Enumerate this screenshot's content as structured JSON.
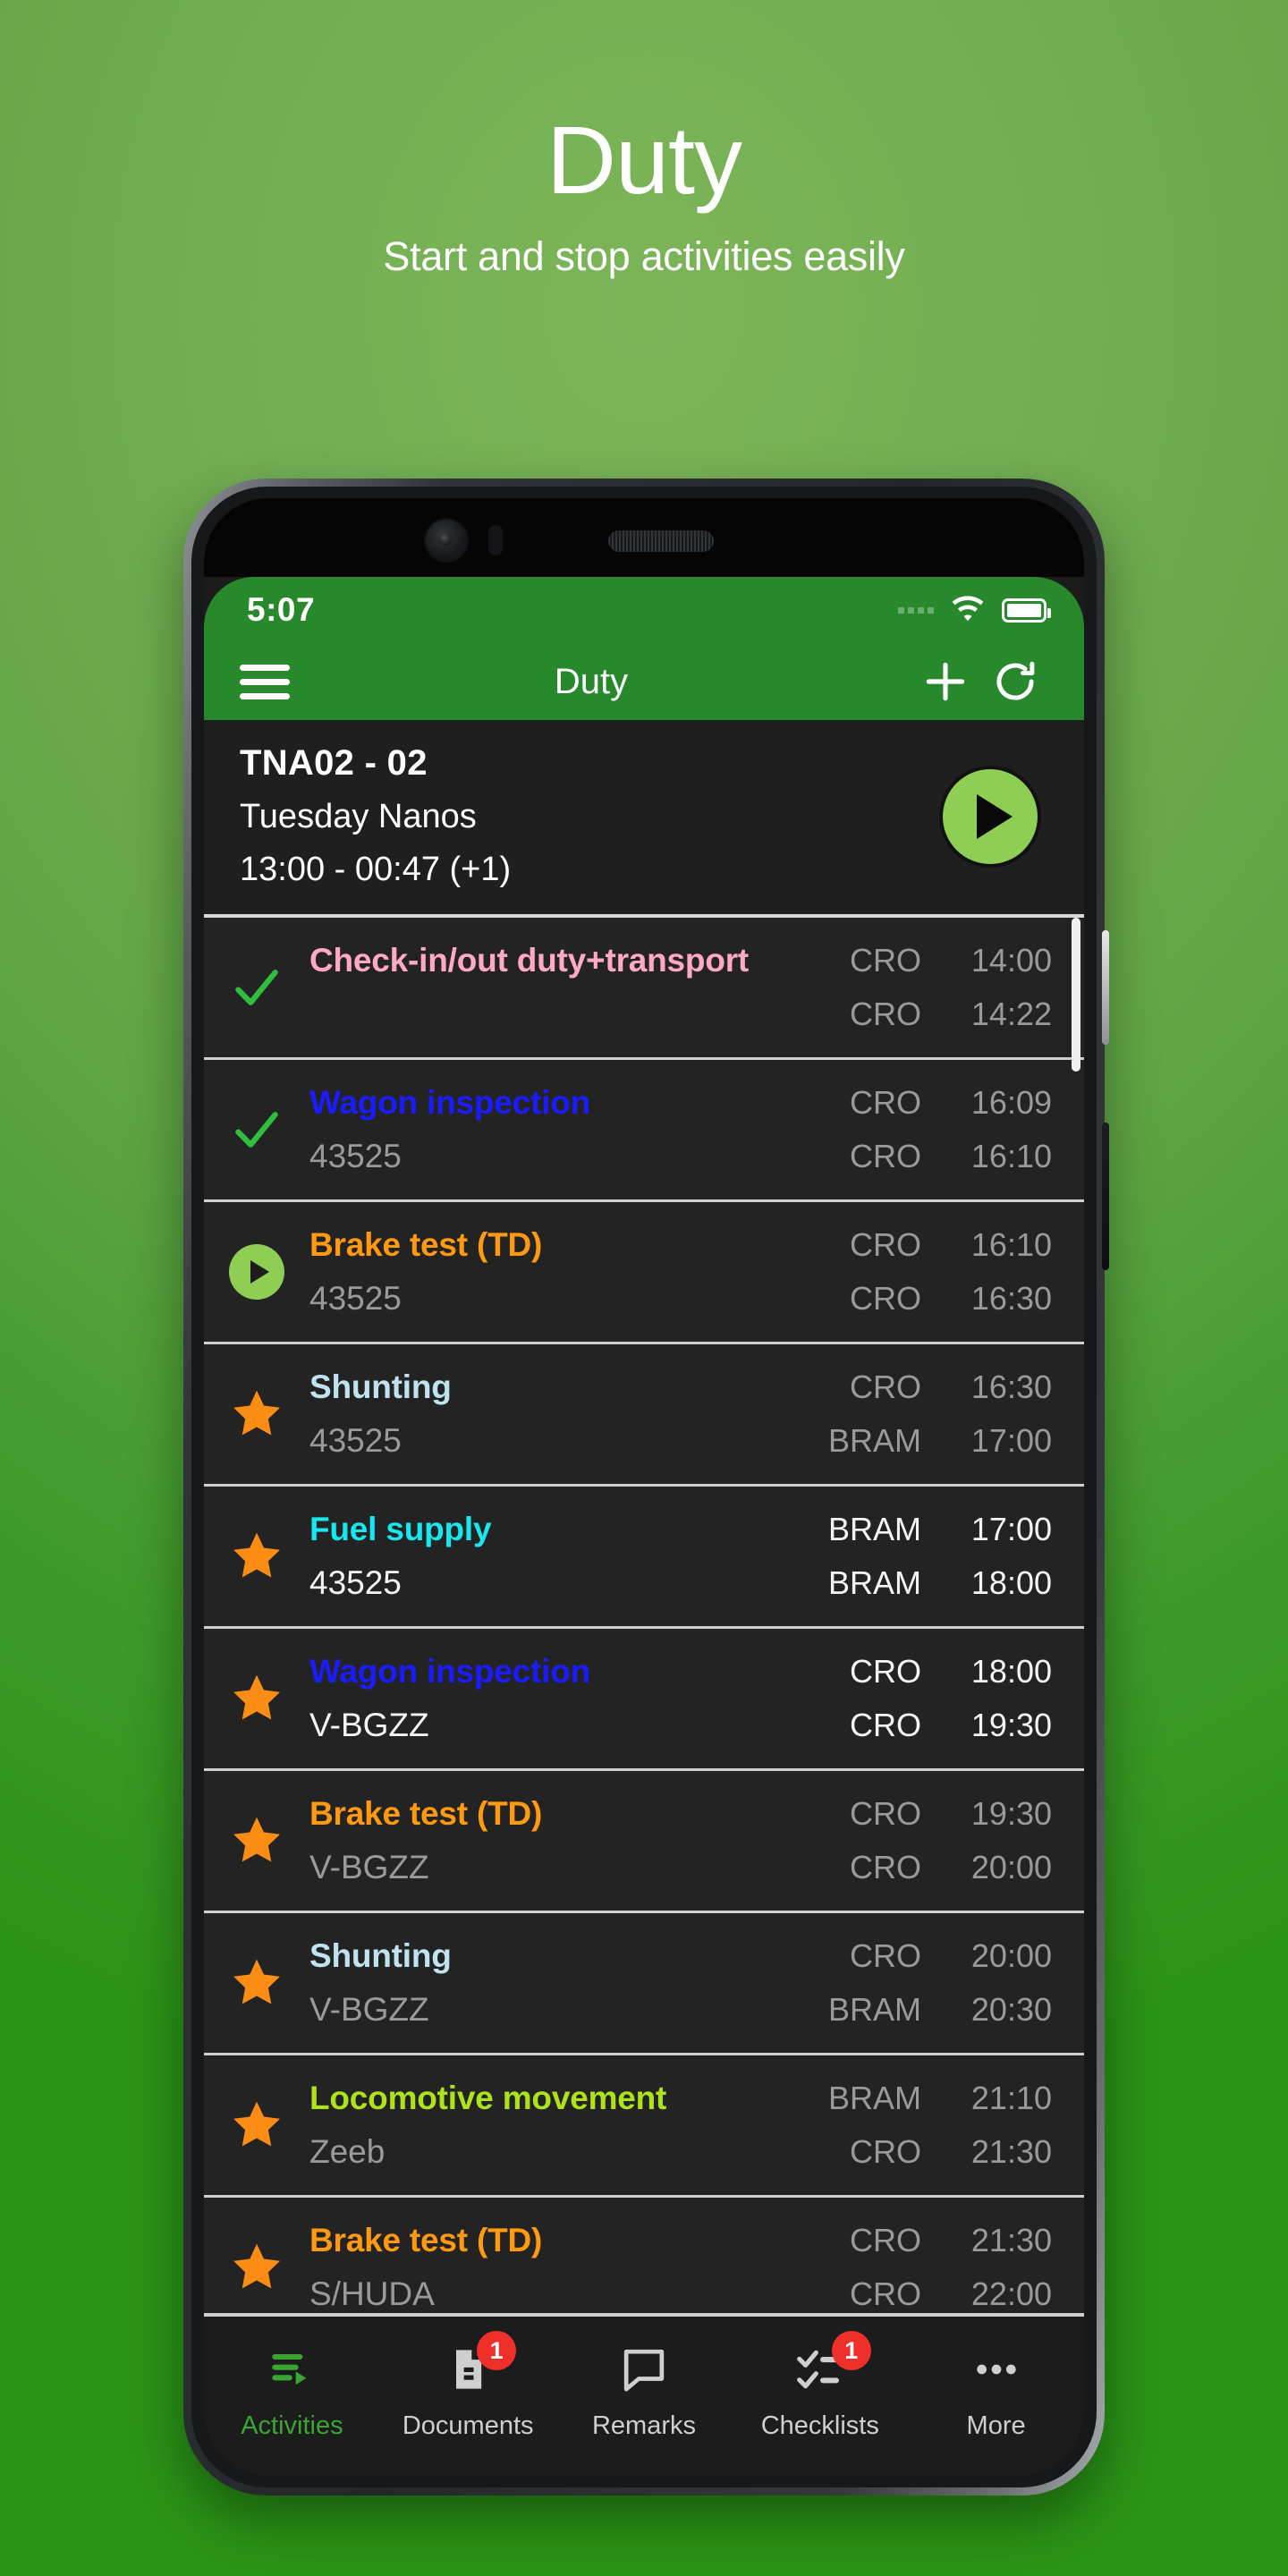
{
  "promo": {
    "title": "Duty",
    "subtitle": "Start and stop activities easily"
  },
  "colors": {
    "brand_green": "#27892b",
    "accent_green": "#8ece55",
    "badge_red": "#ef2f2a",
    "active_nav": "#3aa531",
    "screen_bg": "#1c1c1c",
    "row_bg": "#232323"
  },
  "status_bar": {
    "clock": "5:07",
    "signal_icon": "signal-dots-icon",
    "wifi_icon": "wifi-icon",
    "battery_icon": "battery-full-icon"
  },
  "toolbar": {
    "menu_icon": "hamburger-menu-icon",
    "title": "Duty",
    "add_icon": "plus-icon",
    "refresh_icon": "refresh-icon"
  },
  "duty_header": {
    "code": "TNA02 - 02",
    "name": "Tuesday Nanos",
    "time_range": "13:00 - 00:47 (+1)",
    "play_icon": "play-icon"
  },
  "activities": [
    {
      "status_icon": "check-icon",
      "title": "Check-in/out duty+transport",
      "title_color": "#ffa8c8",
      "subtitle": "",
      "bright": false,
      "from_loc": "CRO",
      "from_time": "14:00",
      "to_loc": "CRO",
      "to_time": "14:22"
    },
    {
      "status_icon": "check-icon",
      "title": "Wagon inspection",
      "title_color": "#1b1bff",
      "subtitle": "43525",
      "bright": false,
      "from_loc": "CRO",
      "from_time": "16:09",
      "to_loc": "CRO",
      "to_time": "16:10"
    },
    {
      "status_icon": "play-circle-icon",
      "title": "Brake test (TD)",
      "title_color": "#ff9a10",
      "subtitle": "43525",
      "bright": false,
      "from_loc": "CRO",
      "from_time": "16:10",
      "to_loc": "CRO",
      "to_time": "16:30"
    },
    {
      "status_icon": "star-icon",
      "title": "Shunting",
      "title_color": "#bfe3ef",
      "subtitle": "43525",
      "bright": false,
      "from_loc": "CRO",
      "from_time": "16:30",
      "to_loc": "BRAM",
      "to_time": "17:00"
    },
    {
      "status_icon": "star-icon",
      "title": "Fuel supply",
      "title_color": "#17e8f0",
      "subtitle": "43525",
      "bright": true,
      "from_loc": "BRAM",
      "from_time": "17:00",
      "to_loc": "BRAM",
      "to_time": "18:00"
    },
    {
      "status_icon": "star-icon",
      "title": "Wagon inspection",
      "title_color": "#1b1bff",
      "subtitle": "V-BGZZ",
      "bright": true,
      "from_loc": "CRO",
      "from_time": "18:00",
      "to_loc": "CRO",
      "to_time": "19:30"
    },
    {
      "status_icon": "star-icon",
      "title": "Brake test (TD)",
      "title_color": "#ff9a10",
      "subtitle": "V-BGZZ",
      "bright": false,
      "from_loc": "CRO",
      "from_time": "19:30",
      "to_loc": "CRO",
      "to_time": "20:00"
    },
    {
      "status_icon": "star-icon",
      "title": "Shunting",
      "title_color": "#bfe3ef",
      "subtitle": "V-BGZZ",
      "bright": false,
      "from_loc": "CRO",
      "from_time": "20:00",
      "to_loc": "BRAM",
      "to_time": "20:30"
    },
    {
      "status_icon": "star-icon",
      "title": "Locomotive movement",
      "title_color": "#aee319",
      "subtitle": "Zeeb",
      "bright": false,
      "from_loc": "BRAM",
      "from_time": "21:10",
      "to_loc": "CRO",
      "to_time": "21:30"
    },
    {
      "status_icon": "star-icon",
      "title": "Brake test (TD)",
      "title_color": "#ff9a10",
      "subtitle": "S/HUDA",
      "bright": false,
      "from_loc": "CRO",
      "from_time": "21:30",
      "to_loc": "CRO",
      "to_time": "22:00"
    }
  ],
  "bottom_nav": [
    {
      "label": "Activities",
      "icon": "activities-icon",
      "active": true,
      "badge": ""
    },
    {
      "label": "Documents",
      "icon": "document-icon",
      "active": false,
      "badge": "1"
    },
    {
      "label": "Remarks",
      "icon": "comment-icon",
      "active": false,
      "badge": ""
    },
    {
      "label": "Checklists",
      "icon": "checklist-icon",
      "active": false,
      "badge": "1"
    },
    {
      "label": "More",
      "icon": "ellipsis-icon",
      "active": false,
      "badge": ""
    }
  ]
}
